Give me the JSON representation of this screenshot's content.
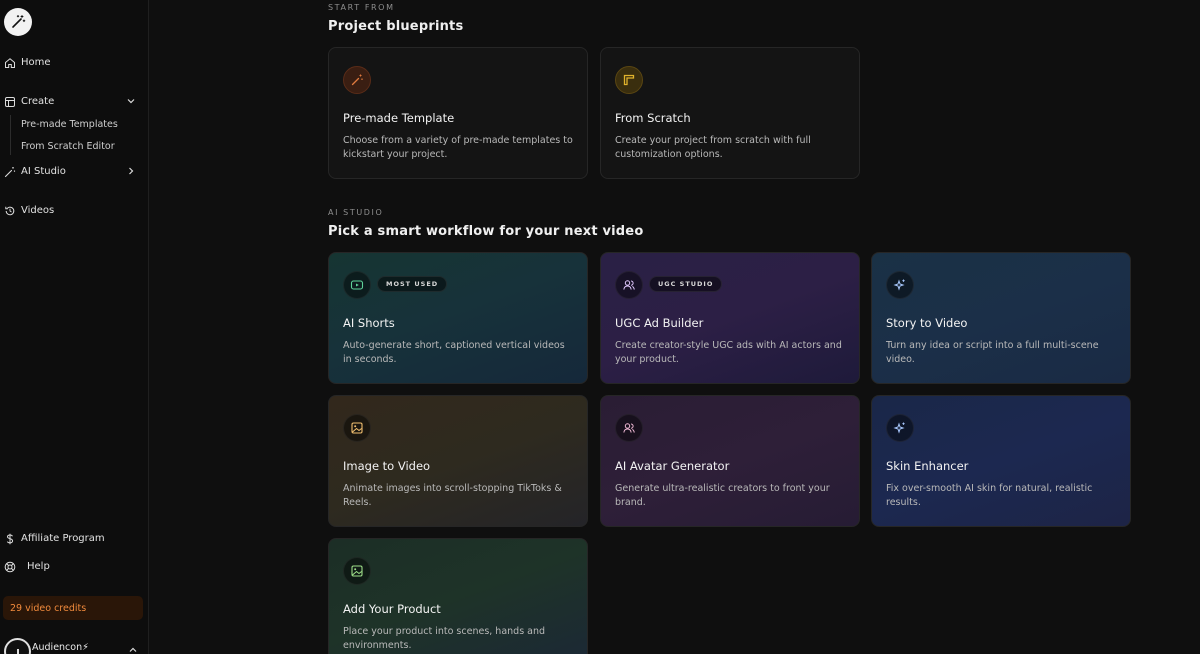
{
  "sidebar": {
    "home": "Home",
    "create": "Create",
    "create_sub": [
      "Pre-made Templates",
      "From Scratch Editor"
    ],
    "ai_studio": "AI Studio",
    "videos": "Videos",
    "affiliate": "Affiliate Program",
    "help": "Help",
    "credits": "29 video credits",
    "user_name": "Audiencon⚡"
  },
  "blueprints": {
    "label": "START FROM",
    "title": "Project blueprints",
    "cards": [
      {
        "title": "Pre-made Template",
        "desc": "Choose from a variety of pre-made templates to kickstart your project.",
        "icon": "magic-wand-icon",
        "accent": "#d9743a"
      },
      {
        "title": "From Scratch",
        "desc": "Create your project from scratch with full customization options.",
        "icon": "frame-icon",
        "accent": "#d4a72a"
      }
    ]
  },
  "studio": {
    "label": "AI STUDIO",
    "title": "Pick a smart workflow for your next video",
    "cards": [
      {
        "title": "AI Shorts",
        "desc": "Auto-generate short, captioned vertical videos in seconds.",
        "badge": "MOST USED",
        "icon": "youtube-icon"
      },
      {
        "title": "UGC Ad Builder",
        "desc": "Create creator-style UGC ads with AI actors and your product.",
        "badge": "UGC STUDIO",
        "icon": "users-icon"
      },
      {
        "title": "Story to Video",
        "desc": "Turn any idea or script into a full multi-scene video.",
        "icon": "sparkles-icon"
      },
      {
        "title": "Image to Video",
        "desc": "Animate images into scroll-stopping TikToks & Reels.",
        "icon": "image-icon"
      },
      {
        "title": "AI Avatar Generator",
        "desc": "Generate ultra-realistic creators to front your brand.",
        "icon": "users-icon"
      },
      {
        "title": "Skin Enhancer",
        "desc": "Fix over-smooth AI skin for natural, realistic results.",
        "icon": "sparkles-icon"
      },
      {
        "title": "Add Your Product",
        "desc": "Place your product into scenes, hands and environments.",
        "icon": "image-icon"
      }
    ]
  }
}
